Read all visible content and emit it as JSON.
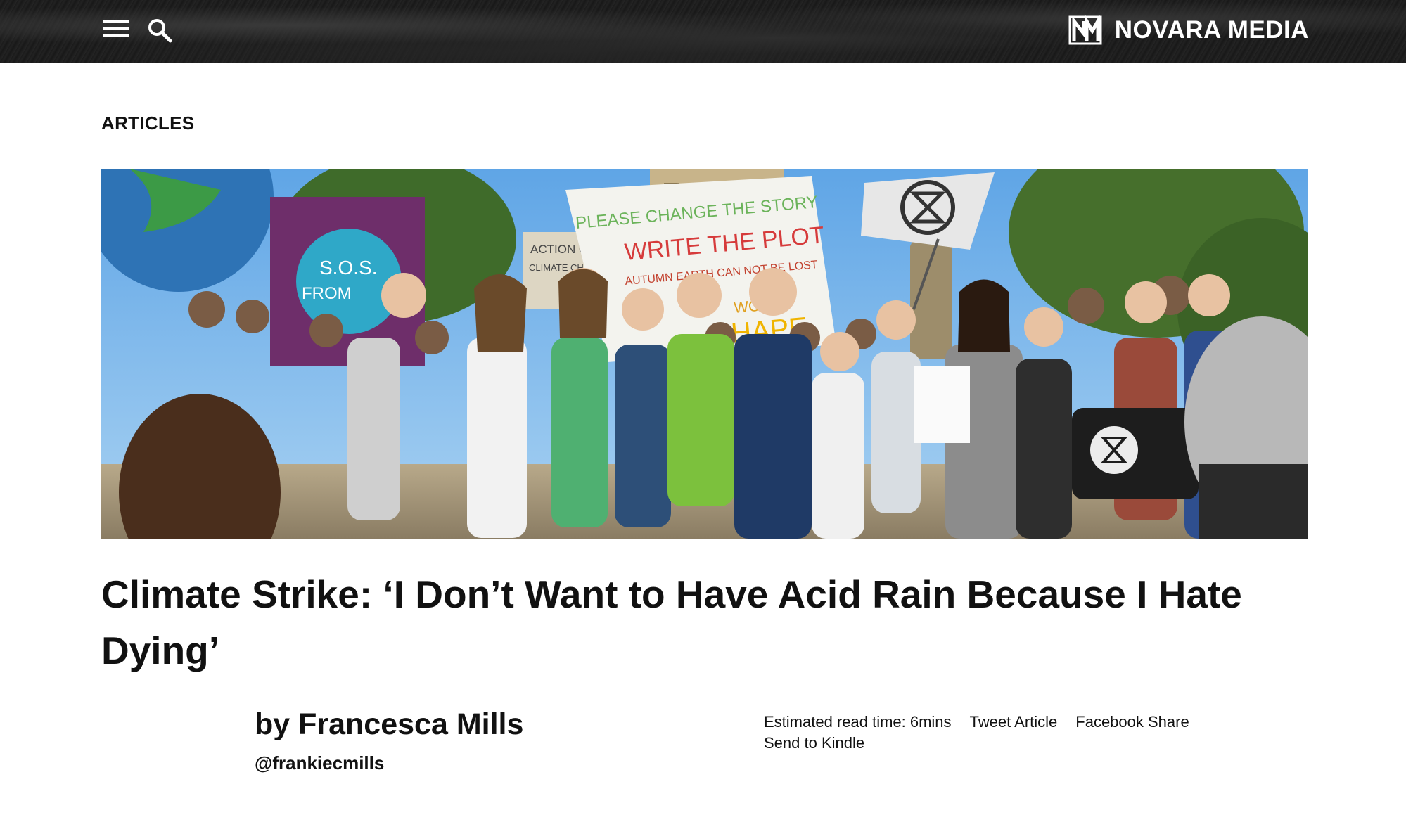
{
  "header": {
    "menu_icon": "hamburger-menu-icon",
    "search_icon": "search-icon",
    "logo_text": "NOVARA MEDIA"
  },
  "section": {
    "label": "ARTICLES"
  },
  "article": {
    "title": "Climate Strike: ‘I Don’t Want to Have Acid Rain Because I Hate Dying’",
    "author": "by Francesca Mills",
    "handle": "@frankiecmills",
    "read_time": "Estimated read time: 6mins",
    "tweet_label": "Tweet Article",
    "facebook_label": "Facebook Share",
    "kindle_label": "Send to Kindle"
  },
  "hero_image": {
    "signs": {
      "sos": "S.O.S.",
      "sos2": "FROM",
      "action": "ACTION ON",
      "climate": "CLIMATE CHANGE",
      "banner_line1": "PLEASE CHANGE THE STORY",
      "banner_line2": "WRITE THE PLOT",
      "banner_line3": "AUTUMN EARTH CAN NOT BE LOST",
      "banner_line4": "WORLD",
      "banner_line5": "SHAPE"
    }
  },
  "colors": {
    "header_bg": "#1c1c1c",
    "text": "#111111",
    "background": "#ffffff"
  }
}
